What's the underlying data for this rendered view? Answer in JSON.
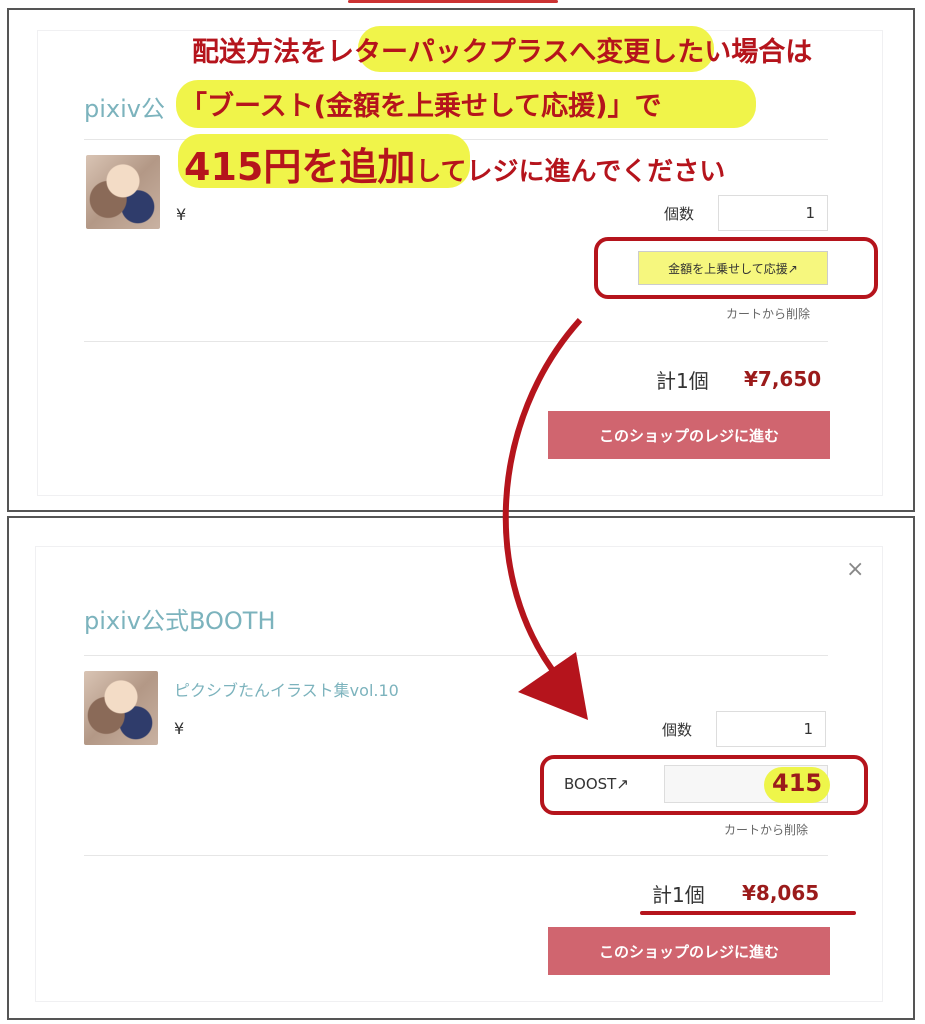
{
  "annotation": {
    "line1_prefix": "配送方法を",
    "line1_highlight": "レターパックプラスへ変更",
    "line1_suffix": "したい場合は",
    "line2_highlight": "「ブースト",
    "line2_rest": "(金額を上乗せして応援)」で",
    "line3_highlight": "415円を追加",
    "line3_rest": "してレジに進んでください"
  },
  "before": {
    "shop_title": "pixiv公",
    "yen": "¥",
    "qty_label": "個数",
    "qty_value": "1",
    "boost_button": "金額を上乗せして応援↗",
    "remove_link": "カートから削除",
    "total_label": "計1個",
    "total_price": "¥7,650",
    "checkout_button": "このショップのレジに進む"
  },
  "after": {
    "close_icon": "×",
    "shop_title": "pixiv公式BOOTH",
    "item_title": "ピクシブたんイラスト集vol.10",
    "yen": "¥",
    "qty_label": "個数",
    "qty_value": "1",
    "boost_label": "BOOST↗",
    "boost_value": "415",
    "remove_link": "カートから削除",
    "total_label": "計1個",
    "total_price": "¥8,065",
    "checkout_button": "このショップのレジに進む"
  },
  "colors": {
    "accent_red": "#b5141c",
    "checkout_button": "#d0656f",
    "highlight_yellow": "#f0f44a",
    "shop_title": "#7cb3bd"
  },
  "icons": [
    "close-icon",
    "external-link-icon",
    "arrow-annotation-icon"
  ]
}
